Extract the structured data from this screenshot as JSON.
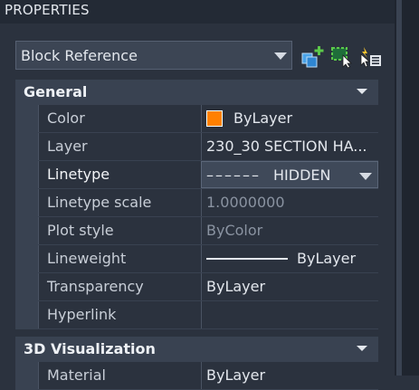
{
  "panel": {
    "title": "PROPERTIES",
    "selector_value": "Block Reference",
    "tool_icons": [
      "quick-select-icon",
      "select-objects-icon",
      "toggle-pickadd-icon"
    ]
  },
  "sections": [
    {
      "label": "General",
      "rows": [
        {
          "name": "Color",
          "value": "ByLayer",
          "swatch_color": "#ff8000"
        },
        {
          "name": "Layer",
          "value": "230_30 SECTION HA..."
        },
        {
          "name": "Linetype",
          "pattern": "––––––",
          "value": "HIDDEN",
          "selected": true
        },
        {
          "name": "Linetype scale",
          "value": "1.0000000",
          "dim": true
        },
        {
          "name": "Plot style",
          "value": "ByColor",
          "dim": true
        },
        {
          "name": "Lineweight",
          "value": "ByLayer"
        },
        {
          "name": "Transparency",
          "value": "ByLayer"
        },
        {
          "name": "Hyperlink",
          "value": ""
        }
      ]
    },
    {
      "label": "3D Visualization",
      "rows": [
        {
          "name": "Material",
          "value": "ByLayer"
        }
      ]
    }
  ]
}
